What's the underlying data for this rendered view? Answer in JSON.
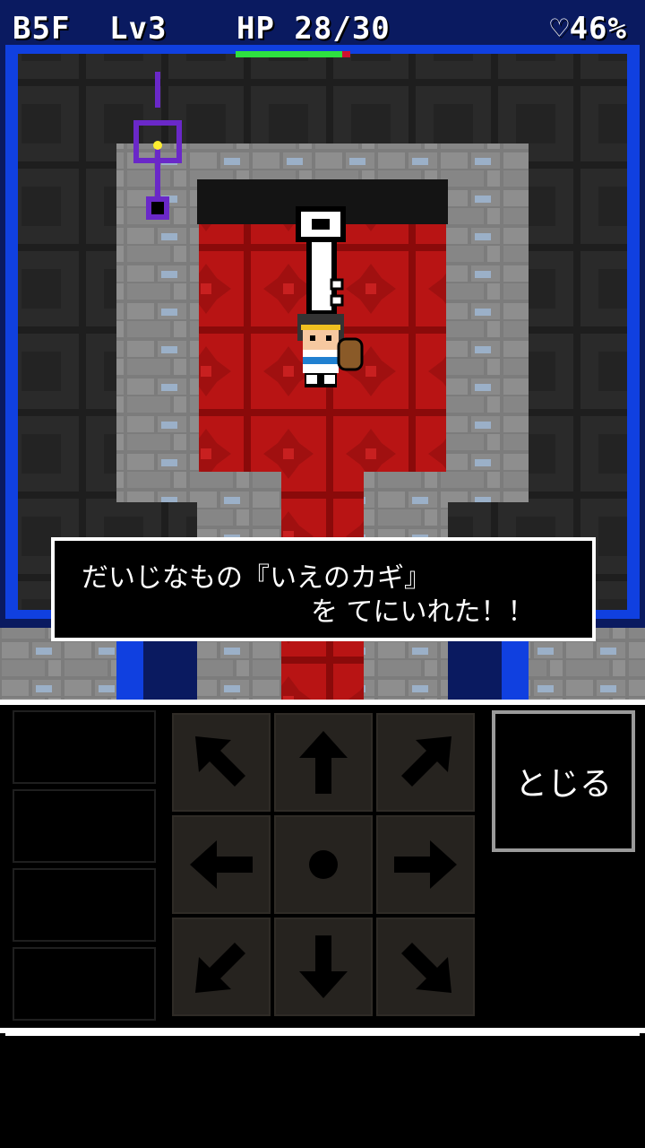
{
  "status": {
    "floor": "B5F",
    "level": "Lv3",
    "hp_label": "HP 28/30",
    "hp_fraction": 0.93,
    "satiety": "♡46%"
  },
  "message": {
    "line1": "だいじなもの『いえのカギ』",
    "line2": "を てにいれた！！"
  },
  "controls": {
    "close_label": "とじる",
    "dpad": [
      "up-left",
      "up",
      "up-right",
      "left",
      "wait",
      "right",
      "down-left",
      "down",
      "down-right"
    ]
  },
  "colors": {
    "wall_blue": "#1040e0",
    "carpet_red": "#b01010",
    "floor_stone": "#8a8a8a",
    "minimap_purple": "#7030c0"
  }
}
